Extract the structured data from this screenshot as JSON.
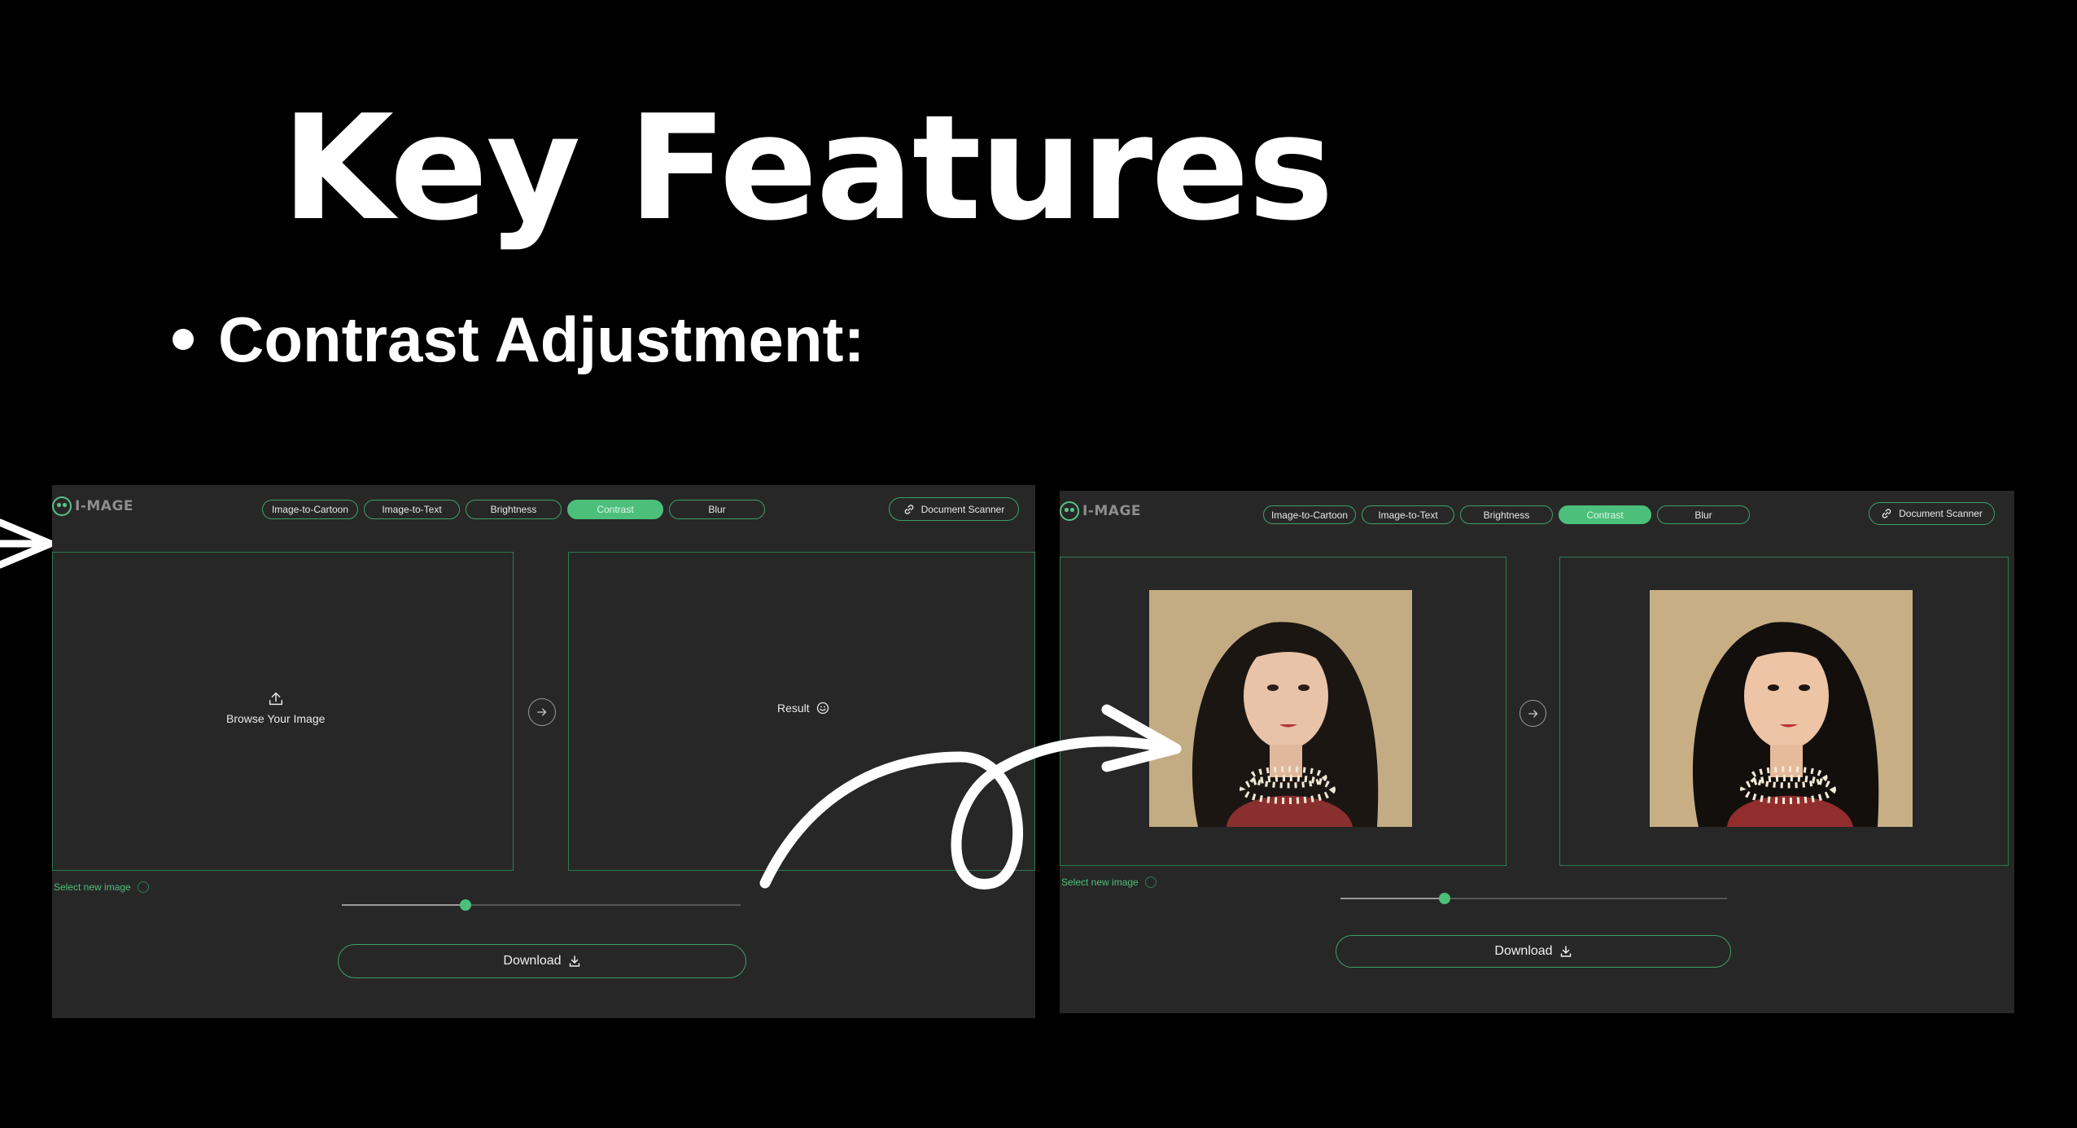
{
  "slide": {
    "title": "Key Features",
    "bullet": "Contrast Adjustment:"
  },
  "app": {
    "logo_text": "I-MAGE",
    "tabs": [
      {
        "label": "Image-to-Cartoon",
        "active": false
      },
      {
        "label": "Image-to-Text",
        "active": false
      },
      {
        "label": "Brightness",
        "active": false
      },
      {
        "label": "Contrast",
        "active": true
      },
      {
        "label": "Blur",
        "active": false
      }
    ],
    "document_scanner_label": "Document Scanner",
    "select_new_label": "Select new image",
    "download_label": "Download",
    "accent_color": "#4cc07a"
  },
  "before_screen": {
    "upload_label": "Browse Your Image",
    "result_label": "Result",
    "slider_value": 0.31
  },
  "after_screen": {
    "slider_value": 0.27
  },
  "icons": {
    "logo": "smiley-logo-icon",
    "link": "link-icon",
    "upload": "upload-icon",
    "arrow": "arrow-right-circle-icon",
    "smile": "smile-icon",
    "download": "download-icon"
  }
}
